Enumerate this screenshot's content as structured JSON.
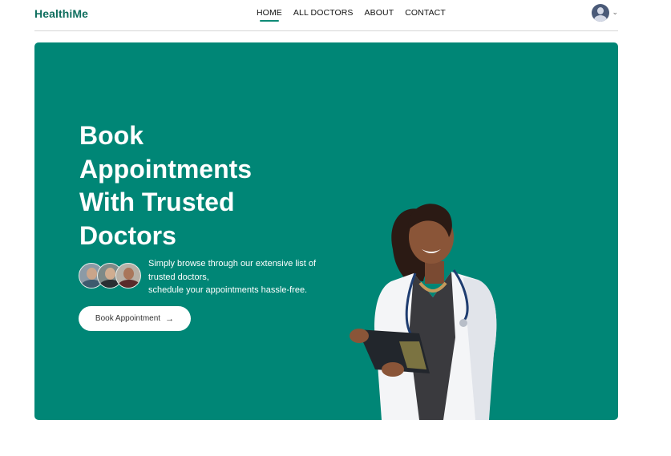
{
  "header": {
    "logo": "HealthiMe",
    "nav": [
      {
        "label": "HOME",
        "active": true
      },
      {
        "label": "ALL DOCTORS",
        "active": false
      },
      {
        "label": "ABOUT",
        "active": false
      },
      {
        "label": "CONTACT",
        "active": false
      }
    ],
    "profile": {
      "avatar_icon": "user-avatar-icon",
      "dropdown_icon": "chevron-down-icon"
    }
  },
  "hero": {
    "title_lines": [
      "Book",
      "Appointments",
      "With Trusted",
      "Doctors"
    ],
    "description_lines": [
      "Simply browse through our extensive list of",
      "trusted doctors,",
      "schedule your appointments hassle-free."
    ],
    "button_label": "Book Appointment",
    "button_icon": "arrow-right-icon",
    "background_color": "#008676",
    "accent_color": "#0e6e5e"
  }
}
